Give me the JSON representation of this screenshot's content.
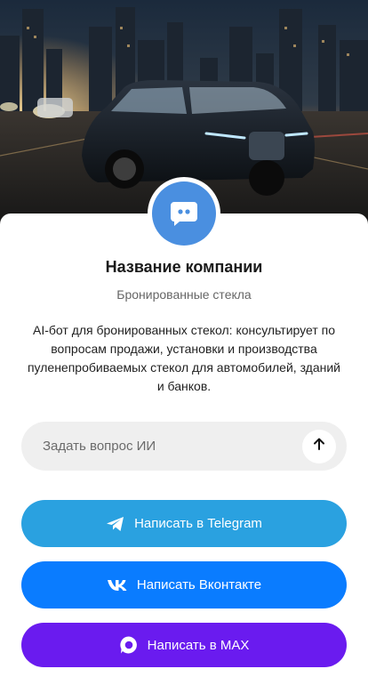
{
  "hero": {
    "image": "black armored SUV on city road at sunset"
  },
  "avatar": {
    "icon": "chat-bubble-icon",
    "color": "#4a8fe0"
  },
  "company": {
    "name": "Название компании",
    "category": "Бронированные стекла",
    "description": "AI-бот для бронированных стекол: консультирует по вопросам продажи, установки и производства пуленепробиваемых стекол для автомобилей, зданий и банков."
  },
  "ask": {
    "placeholder": "Задать вопрос ИИ",
    "send_icon": "arrow-up-icon"
  },
  "buttons": {
    "telegram": {
      "label": "Написать в Telegram",
      "icon": "telegram-icon",
      "color": "#2aa1e0"
    },
    "vk": {
      "label": "Написать Вконтакте",
      "icon": "vk-icon",
      "color": "#0a7cff"
    },
    "max": {
      "label": "Написать в MAX",
      "icon": "max-icon",
      "color": "#6a1bef"
    }
  }
}
